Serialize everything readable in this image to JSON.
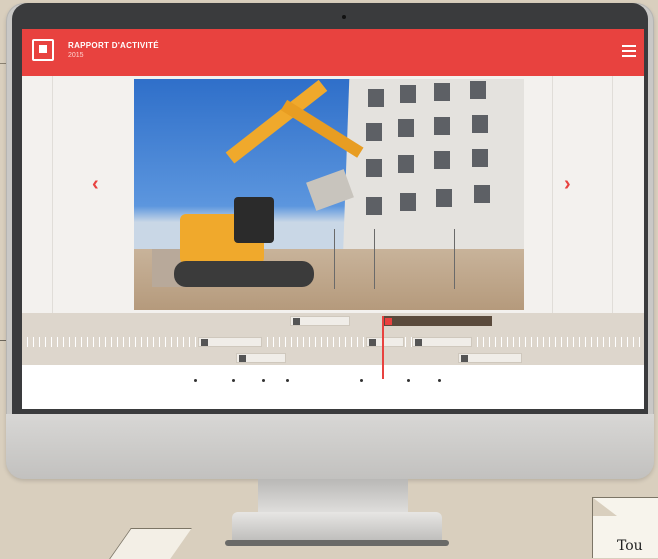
{
  "app": {
    "title": "RAPPORT D'ACTIVITÉ",
    "year": "2015"
  },
  "nav": {
    "prev_arrow": "‹",
    "next_arrow": "›",
    "prev_caption": "",
    "next_caption": ""
  },
  "timeline": {
    "cards": [
      "",
      "",
      "",
      "",
      "",
      "",
      ""
    ],
    "axis_labels": [
      "",
      "",
      "",
      "",
      "",
      ""
    ]
  },
  "callout": {
    "text": "Tou"
  },
  "colors": {
    "accent": "#e8423f",
    "timeline_band": "#ddd6cc"
  }
}
